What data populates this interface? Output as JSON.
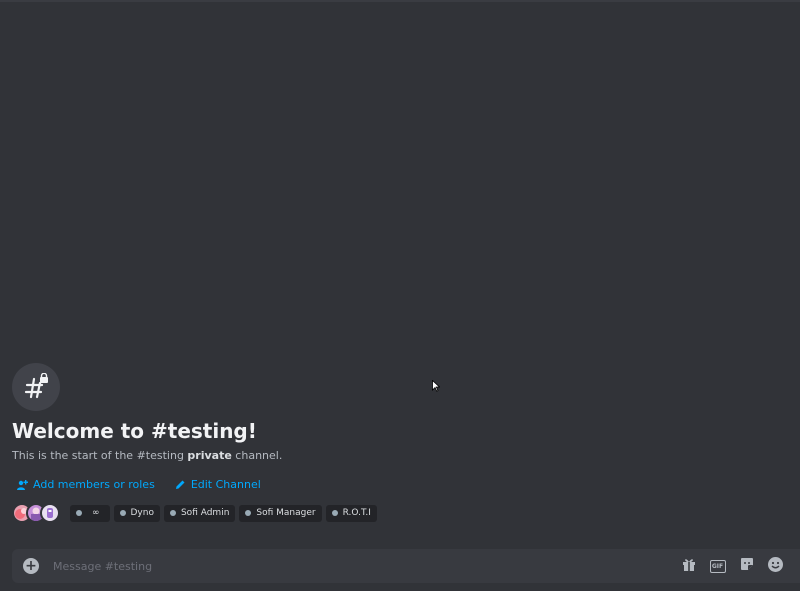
{
  "channel": {
    "icon": "hashtag-lock-icon",
    "welcome_title": "Welcome to #testing!",
    "intro_before": "This is the start of the #testing ",
    "intro_bold": "private",
    "intro_after": " channel."
  },
  "actions": {
    "add_members": "Add members or roles",
    "edit_channel": "Edit Channel"
  },
  "members": {
    "avatars": [
      "avatar-1",
      "avatar-2",
      "avatar-3"
    ],
    "roles": [
      "∞",
      "Dyno",
      "Sofi Admin",
      "Sofi Manager",
      "R.O.T.I"
    ]
  },
  "composer": {
    "placeholder": "Message #testing"
  },
  "colors": {
    "background": "#313338",
    "composer": "#383a40",
    "link": "#00a8fc",
    "title": "#f2f3f5",
    "muted": "#b5bac1"
  }
}
